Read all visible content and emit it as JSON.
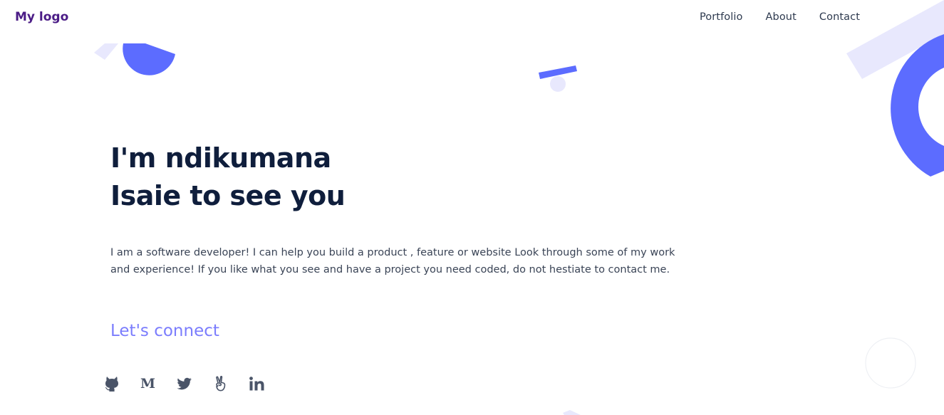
{
  "nav": {
    "logo": "My logo",
    "links": [
      {
        "label": "Portfolio"
      },
      {
        "label": "About"
      },
      {
        "label": "Contact"
      }
    ]
  },
  "hero": {
    "title_line1": "I'm ndikumana",
    "title_line2": "Isaie to see you",
    "description": "I am a software developer! I can help you build a product , feature or website Look through some of my work and experience! If you like what you see and have a project you need coded, do not hestiate to contact me.",
    "connect_label": "Let's connect"
  },
  "socials": [
    {
      "icon": "github-icon"
    },
    {
      "icon": "medium-icon",
      "glyph": "M"
    },
    {
      "icon": "twitter-icon"
    },
    {
      "icon": "angellist-icon"
    },
    {
      "icon": "linkedin-icon"
    }
  ],
  "colors": {
    "logo": "#4b1c86",
    "title": "#0f1e3c",
    "accent": "#7b7dfd",
    "shape_blue": "#5c6cff",
    "shape_lavender": "#e8e8fd"
  }
}
